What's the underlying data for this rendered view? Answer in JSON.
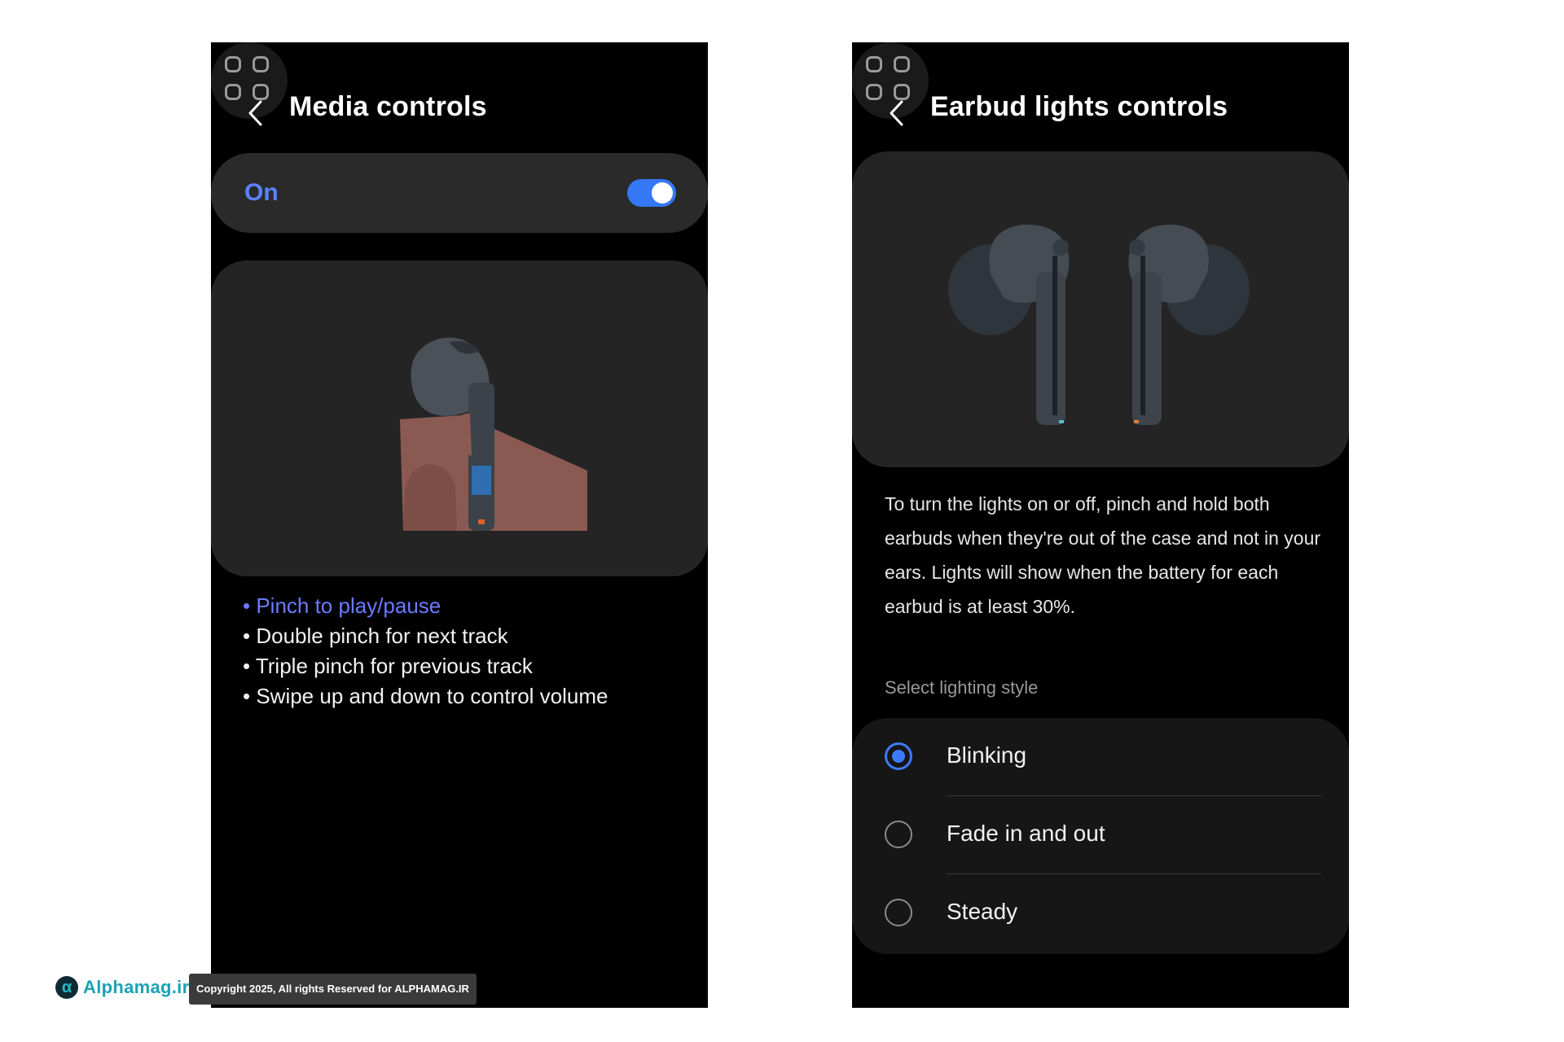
{
  "media_screen": {
    "title": "Media controls",
    "toggle": {
      "label": "On",
      "state": true
    },
    "instructions": [
      "• Pinch to play/pause",
      "• Double pinch for next track",
      "• Triple pinch for previous track",
      "• Swipe up and down to control volume"
    ],
    "active_instruction": 0
  },
  "lights_screen": {
    "title": "Earbud lights controls",
    "description": "To turn the lights on or off, pinch and hold both earbuds when they're out of the case and not in your ears. Lights will show when the battery for each earbud is at least 30%.",
    "section_label": "Select lighting style",
    "options": [
      {
        "label": "Blinking",
        "selected": true
      },
      {
        "label": "Fade in and out",
        "selected": false
      },
      {
        "label": "Steady",
        "selected": false
      }
    ]
  },
  "watermark": {
    "brand": "Alphamag.ir",
    "copyright": "Copyright 2025, All rights Reserved for ALPHAMAG.IR"
  },
  "colors": {
    "accent_blue": "#3478f6",
    "instruction_highlight": "#6b7bff",
    "card_dark": "#2a2a2b",
    "watermark_teal": "#19a3b3"
  },
  "icons": [
    "apps-grid-icon",
    "back-chevron-icon",
    "earbud-pinch-illustration",
    "earbuds-illustration",
    "alphamag-logo-icon"
  ]
}
